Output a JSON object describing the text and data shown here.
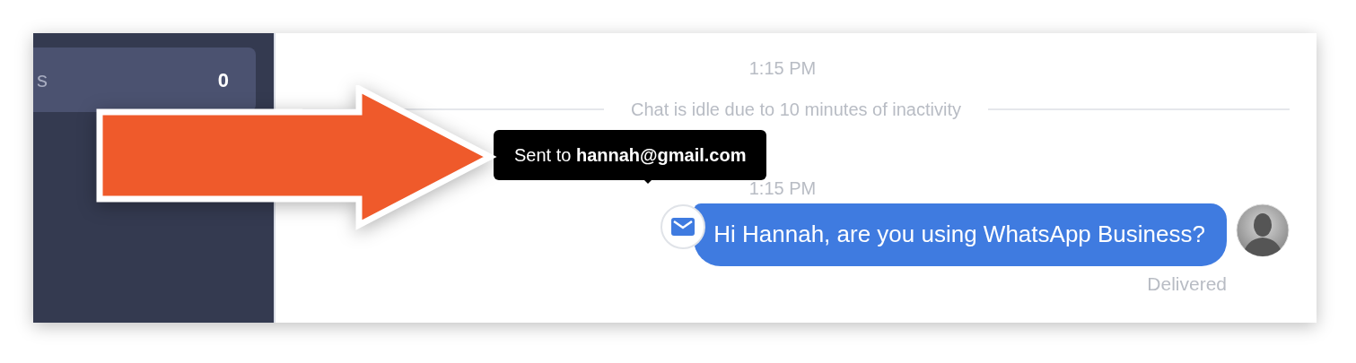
{
  "sidebar": {
    "items": [
      {
        "label": "s",
        "count": "0",
        "selected": true
      }
    ]
  },
  "chat": {
    "items": [
      {
        "kind": "timestamp",
        "text": "1:15 PM"
      },
      {
        "kind": "system",
        "text": "Chat is idle due to 10 minutes of inactivity"
      },
      {
        "kind": "timestamp",
        "text": "1:15 PM"
      },
      {
        "kind": "message",
        "text": "Hi Hannah, are you using WhatsApp Business?",
        "status": "Delivered",
        "tooltip": "Sent to **hannah@gmail.com**"
      }
    ]
  }
}
